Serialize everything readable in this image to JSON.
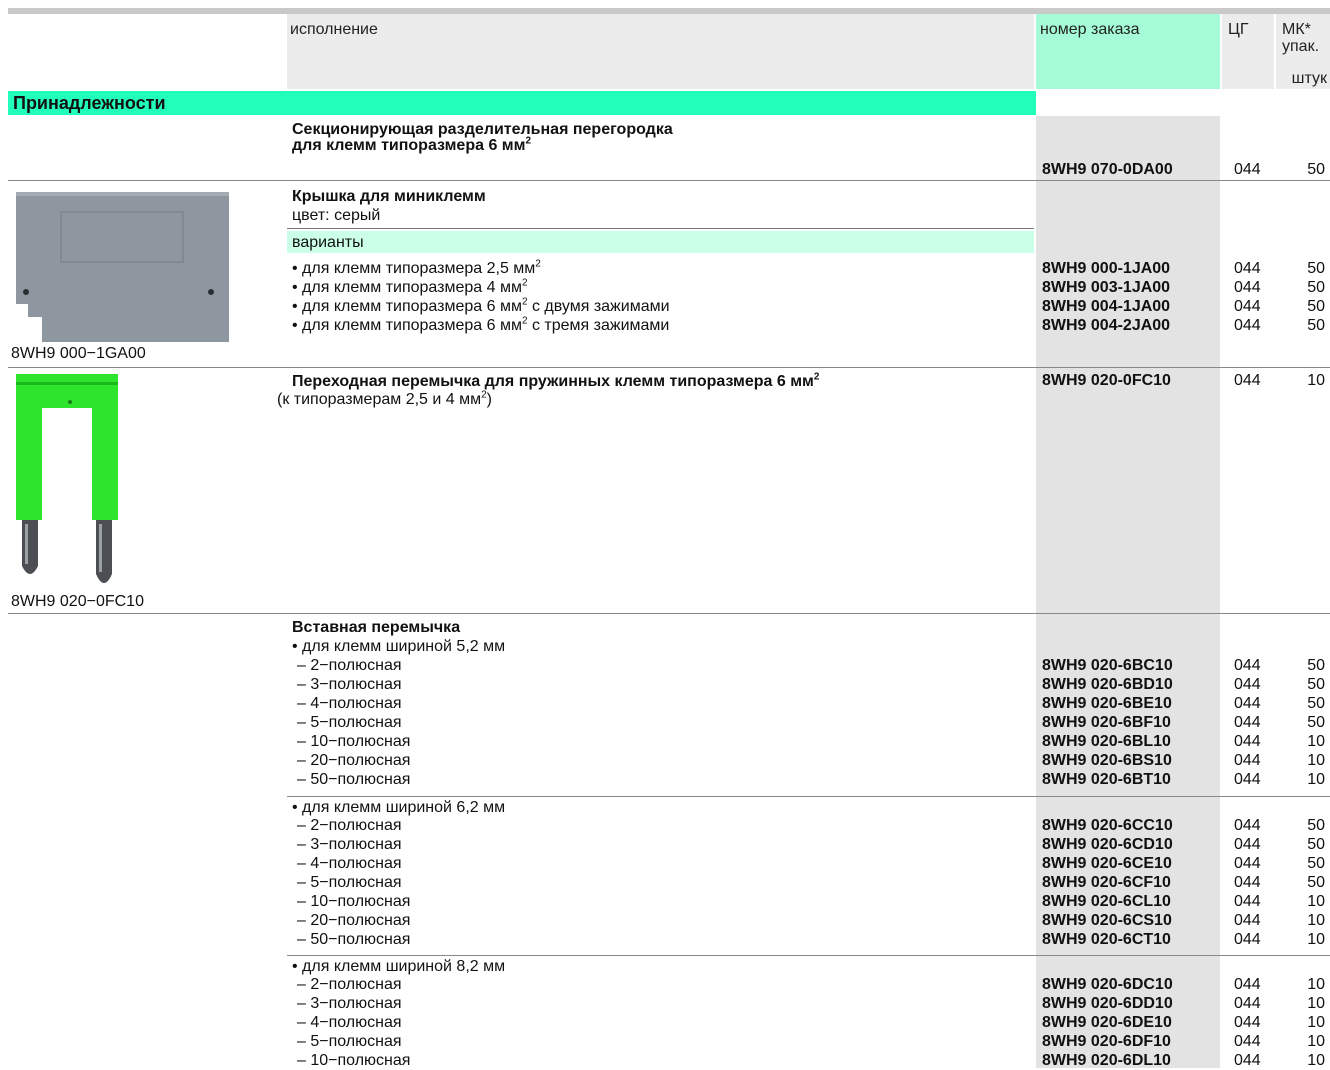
{
  "header": {
    "execution": "исполнение",
    "order_number": "номер заказа",
    "cg": "ЦГ",
    "mk_line1": "МК*",
    "mk_line2": "упак.",
    "pcs": "штук"
  },
  "section_title": "Принадлежности",
  "item1": {
    "title_line1": "Секционирующая разделительная перегородка",
    "title_line2": "для клемм типоразмера 6 мм",
    "sup": "2",
    "code": "8WH9 070-0DA00",
    "cg": "044",
    "mk": "50"
  },
  "item2": {
    "title": "Крышка для миниклемм",
    "subtitle": "цвет: серый",
    "variants_label": "варианты",
    "image_caption": "8WH9 000−1GA00",
    "rows": [
      {
        "text": "• для клемм типоразмера 2,5 мм",
        "sup": "2",
        "suffix": "",
        "code": "8WH9 000-1JA00",
        "cg": "044",
        "mk": "50"
      },
      {
        "text": "• для клемм типоразмера 4 мм",
        "sup": "2",
        "suffix": "",
        "code": "8WH9 003-1JA00",
        "cg": "044",
        "mk": "50"
      },
      {
        "text": "• для клемм типоразмера 6 мм",
        "sup": "2",
        "suffix": " с двумя зажимами",
        "code": "8WH9 004-1JA00",
        "cg": "044",
        "mk": "50"
      },
      {
        "text": "• для клемм типоразмера 6 мм",
        "sup": "2",
        "suffix": " с тремя зажимами",
        "code": "8WH9 004-2JA00",
        "cg": "044",
        "mk": "50"
      }
    ]
  },
  "item3": {
    "title": "Переходная перемычка для пружинных клемм типоразмера 6 мм",
    "sup": "2",
    "subtitle_a": "(к типоразмерам 2,5 и 4 мм",
    "subtitle_sup": "2",
    "subtitle_b": ")",
    "code": "8WH9 020-0FC10",
    "cg": "044",
    "mk": "10",
    "image_caption": "8WH9 020−0FC10"
  },
  "item4": {
    "title": "Вставная перемычка",
    "groups": [
      {
        "label": "• для клемм шириной 5,2 мм",
        "rows": [
          {
            "text": "– 2−полюсная",
            "code": "8WH9 020-6BC10",
            "cg": "044",
            "mk": "50"
          },
          {
            "text": "– 3−полюсная",
            "code": "8WH9 020-6BD10",
            "cg": "044",
            "mk": "50"
          },
          {
            "text": "– 4−полюсная",
            "code": "8WH9 020-6BE10",
            "cg": "044",
            "mk": "50"
          },
          {
            "text": "– 5−полюсная",
            "code": "8WH9 020-6BF10",
            "cg": "044",
            "mk": "50"
          },
          {
            "text": "– 10−полюсная",
            "code": "8WH9 020-6BL10",
            "cg": "044",
            "mk": "10"
          },
          {
            "text": "– 20−полюсная",
            "code": "8WH9 020-6BS10",
            "cg": "044",
            "mk": "10"
          },
          {
            "text": "– 50−полюсная",
            "code": "8WH9 020-6BT10",
            "cg": "044",
            "mk": "10"
          }
        ]
      },
      {
        "label": "• для клемм шириной 6,2 мм",
        "rows": [
          {
            "text": "– 2−полюсная",
            "code": "8WH9 020-6CC10",
            "cg": "044",
            "mk": "50"
          },
          {
            "text": "– 3−полюсная",
            "code": "8WH9 020-6CD10",
            "cg": "044",
            "mk": "50"
          },
          {
            "text": "– 4−полюсная",
            "code": "8WH9 020-6CE10",
            "cg": "044",
            "mk": "50"
          },
          {
            "text": "– 5−полюсная",
            "code": "8WH9 020-6CF10",
            "cg": "044",
            "mk": "50"
          },
          {
            "text": "– 10−полюсная",
            "code": "8WH9 020-6CL10",
            "cg": "044",
            "mk": "10"
          },
          {
            "text": "– 20−полюсная",
            "code": "8WH9 020-6CS10",
            "cg": "044",
            "mk": "10"
          },
          {
            "text": "– 50−полюсная",
            "code": "8WH9 020-6CT10",
            "cg": "044",
            "mk": "10"
          }
        ]
      },
      {
        "label": "• для клемм шириной 8,2 мм",
        "rows": [
          {
            "text": "– 2−полюсная",
            "code": "8WH9 020-6DC10",
            "cg": "044",
            "mk": "10"
          },
          {
            "text": "– 3−полюсная",
            "code": "8WH9 020-6DD10",
            "cg": "044",
            "mk": "10"
          },
          {
            "text": "– 4−полюсная",
            "code": "8WH9 020-6DE10",
            "cg": "044",
            "mk": "10"
          },
          {
            "text": "– 5−полюсная",
            "code": "8WH9 020-6DF10",
            "cg": "044",
            "mk": "10"
          },
          {
            "text": "– 10−полюсная",
            "code": "8WH9 020-6DL10",
            "cg": "044",
            "mk": "10"
          }
        ]
      }
    ]
  },
  "colors": {
    "accent_green": "#22ffbb",
    "order_header_green": "#a6fbd7",
    "variants_green": "#ccffe8",
    "column_grey": "#e3e3e3",
    "cover_grey": "#8e979f",
    "jumper_green": "#2ee52e"
  }
}
